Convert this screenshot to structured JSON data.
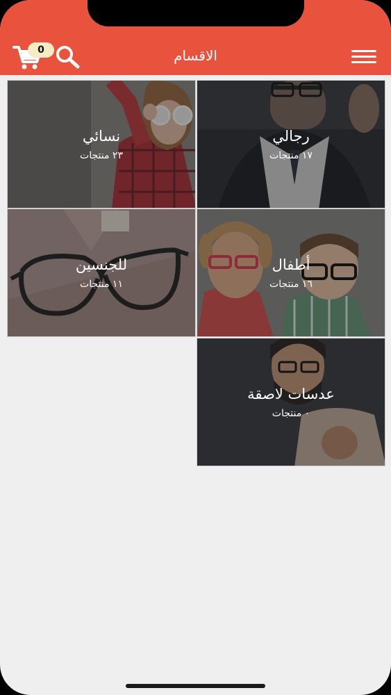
{
  "header": {
    "title": "الاقسام",
    "cart_count": "0",
    "background": "#e9523c"
  },
  "icons": {
    "menu": "hamburger-icon",
    "cart": "shopping-cart-icon",
    "search": "search-icon"
  },
  "categories": [
    {
      "title": "رجالي",
      "count": "١٧ منتجات"
    },
    {
      "title": "نسائي",
      "count": "٢٣ منتجات"
    },
    {
      "title": "أطفال",
      "count": "١٦ منتجات"
    },
    {
      "title": "للجنسين",
      "count": "١١ منتجات"
    },
    {
      "title": "عدسات لاصقة",
      "count": "٠ منتجات"
    }
  ]
}
